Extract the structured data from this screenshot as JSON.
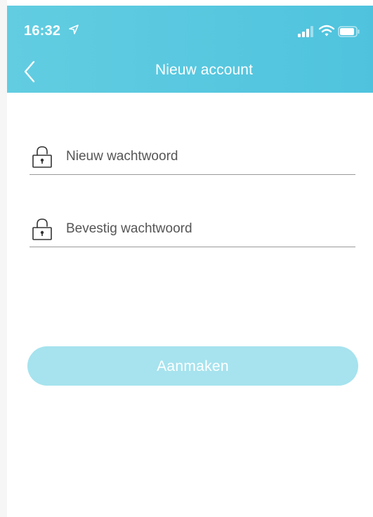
{
  "status_bar": {
    "time": "16:32",
    "location_icon": "location-arrow-icon",
    "signal_icon": "cellular-signal-icon",
    "wifi_icon": "wifi-icon",
    "battery_icon": "battery-icon"
  },
  "nav": {
    "back_icon": "chevron-left-icon",
    "title": "Nieuw account"
  },
  "form": {
    "new_password": {
      "icon": "lock-icon",
      "value": "",
      "placeholder": "Nieuw wachtwoord"
    },
    "confirm_password": {
      "icon": "lock-icon",
      "value": "",
      "placeholder": "Bevestig wachtwoord"
    },
    "submit_label": "Aanmaken"
  },
  "colors": {
    "header": "#56c8e0",
    "button": "#a6e3ee",
    "underline": "#9a9a9a"
  }
}
